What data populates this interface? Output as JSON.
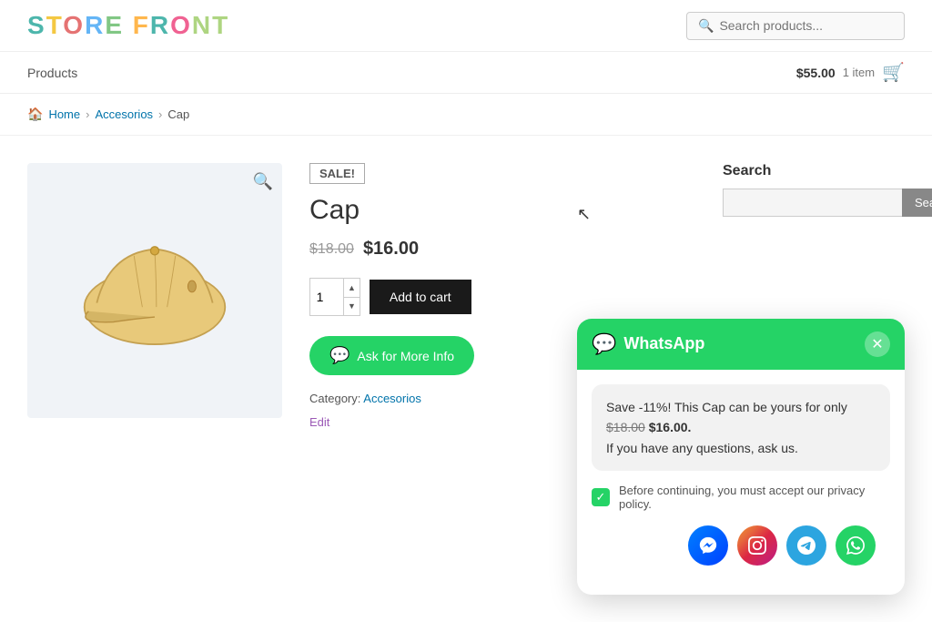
{
  "header": {
    "logo_text": "STORE FRONT",
    "search_placeholder": "Search products..."
  },
  "navbar": {
    "products_label": "Products",
    "cart_price": "$55.00",
    "cart_items": "1 item"
  },
  "breadcrumb": {
    "home": "Home",
    "category": "Accesorios",
    "current": "Cap"
  },
  "product": {
    "sale_badge": "SALE!",
    "name": "Cap",
    "original_price": "$18.00",
    "sale_price": "$16.00",
    "quantity": "1",
    "add_to_cart_label": "Add to cart",
    "ask_btn_label": "Ask for More Info",
    "category_label": "Category:",
    "category_link": "Accesorios",
    "edit_label": "Edit"
  },
  "sidebar": {
    "search_label": "Search",
    "search_placeholder": "",
    "search_btn": "Search"
  },
  "whatsapp_popup": {
    "title": "WhatsApp",
    "message_line1": "Save -11%! This Cap can be yours for only",
    "message_price_old": "$18.00",
    "message_price_new": "$16.00.",
    "message_line2": "If you have any questions, ask us.",
    "privacy_text": "Before continuing, you must accept our privacy policy."
  }
}
